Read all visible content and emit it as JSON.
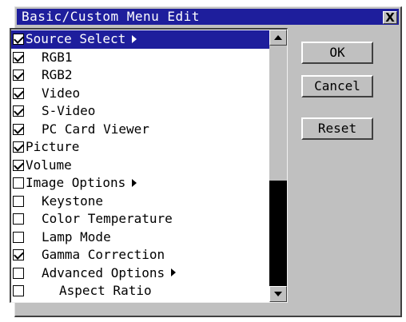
{
  "window": {
    "title": "Basic/Custom Menu Edit",
    "close_label": "X"
  },
  "list": {
    "items": [
      {
        "label": "Source Select",
        "checked": true,
        "level": 0,
        "submenu": true,
        "selected": true
      },
      {
        "label": "RGB1",
        "checked": true,
        "level": 1,
        "submenu": false
      },
      {
        "label": "RGB2",
        "checked": true,
        "level": 1,
        "submenu": false
      },
      {
        "label": "Video",
        "checked": true,
        "level": 1,
        "submenu": false
      },
      {
        "label": "S-Video",
        "checked": true,
        "level": 1,
        "submenu": false
      },
      {
        "label": "PC Card Viewer",
        "checked": true,
        "level": 1,
        "submenu": false
      },
      {
        "label": "Picture",
        "checked": true,
        "level": 0,
        "submenu": false
      },
      {
        "label": "Volume",
        "checked": true,
        "level": 0,
        "submenu": false
      },
      {
        "label": "Image Options",
        "checked": false,
        "level": 0,
        "submenu": true
      },
      {
        "label": "Keystone",
        "checked": false,
        "level": 1,
        "submenu": false
      },
      {
        "label": "Color Temperature",
        "checked": false,
        "level": 1,
        "submenu": false
      },
      {
        "label": "Lamp Mode",
        "checked": false,
        "level": 1,
        "submenu": false
      },
      {
        "label": "Gamma Correction",
        "checked": true,
        "level": 1,
        "submenu": false
      },
      {
        "label": "Advanced Options",
        "checked": false,
        "level": 1,
        "submenu": true
      },
      {
        "label": "Aspect Ratio",
        "checked": false,
        "level": 2,
        "submenu": false
      }
    ],
    "scroll_position": 0.56,
    "visible_fraction": 0.44
  },
  "buttons": {
    "ok": "OK",
    "cancel": "Cancel",
    "reset": "Reset"
  },
  "colors": {
    "titlebar": "#1e1e9c",
    "selection": "#1e1e9c",
    "face": "#c0c0c0"
  }
}
